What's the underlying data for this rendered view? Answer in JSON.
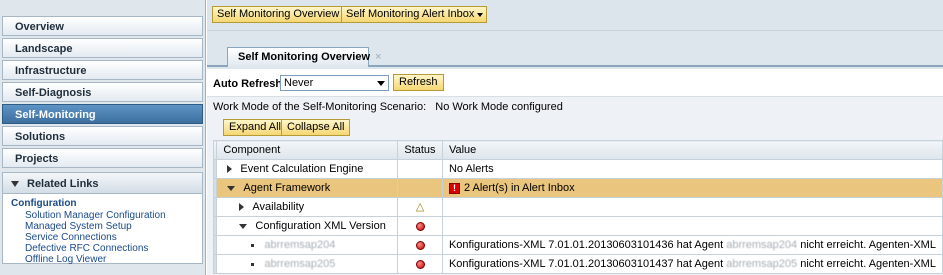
{
  "nav": {
    "items": [
      {
        "label": "Overview",
        "active": false
      },
      {
        "label": "Landscape",
        "active": false
      },
      {
        "label": "Infrastructure",
        "active": false
      },
      {
        "label": "Self-Diagnosis",
        "active": false
      },
      {
        "label": "Self-Monitoring",
        "active": true
      },
      {
        "label": "Solutions",
        "active": false
      },
      {
        "label": "Projects",
        "active": false
      }
    ],
    "related": {
      "header": "Related Links",
      "section": "Configuration",
      "links": [
        "Solution Manager Configuration",
        "Managed System Setup",
        "Service Connections",
        "Defective RFC Connections",
        "Offline Log Viewer"
      ]
    }
  },
  "topbar": {
    "buttons": [
      "Self Monitoring Overview",
      "Self Monitoring Alert Inbox"
    ]
  },
  "tabs": {
    "active_tab": "Self Monitoring Overview",
    "close_glyph": "×"
  },
  "refresh": {
    "label": "Auto Refresh",
    "value": "Never",
    "button": "Refresh"
  },
  "workmode": {
    "label": "Work Mode of the Self-Monitoring Scenario:",
    "value": "No Work Mode configured"
  },
  "actions": {
    "expand_all": "Expand All",
    "collapse_all": "Collapse All"
  },
  "table": {
    "headers": {
      "component": "Component",
      "status": "Status",
      "value": "Value"
    },
    "rows": [
      {
        "component": "Event Calculation Engine",
        "status": "",
        "value": "No Alerts"
      },
      {
        "component": "Agent Framework",
        "status": "",
        "value": "2 Alert(s) in Alert Inbox"
      },
      {
        "component": "Availability",
        "status": "warning",
        "value": ""
      },
      {
        "component": "Configuration XML Version",
        "status": "error",
        "value": ""
      },
      {
        "component": "abrremsap204",
        "status": "error",
        "value_a": "Konfigurations-XML 7.01.01.20130603101436 hat Agent",
        "value_b": "abrremsap204",
        "value_c": "nicht erreicht. Agenten-XML"
      },
      {
        "component": "abrremsap205",
        "status": "error",
        "value_a": "Konfigurations-XML 7.01.01.20130603101437 hat Agent",
        "value_b": "abrremsap205",
        "value_c": "nicht erreicht. Agenten-XML"
      }
    ]
  },
  "colors": {
    "accent": "#3d6f9e",
    "button_yellow": "#f5d773",
    "highlight_row": "#e9c57d",
    "error": "#c40000"
  }
}
